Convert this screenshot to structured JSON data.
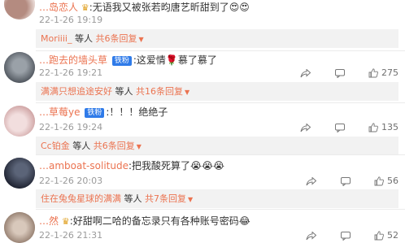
{
  "comments": [
    {
      "user": "…岛恋人",
      "crown": "♛",
      "text": ":无语我又被张若昀唐艺昕甜到了",
      "emoji": "😍😍",
      "date": "22-1-26 19:19",
      "reply": {
        "users": "Moriiii_",
        "and_others": "等人",
        "count_label": "共6条回复",
        "arrow": "▼"
      }
    },
    {
      "user": "…跑去的墙头草",
      "badge": "铁粉",
      "text": ":这爱情",
      "text2": "慕了慕了",
      "emoji": "🌹",
      "date": "22-1-26 19:21",
      "share": "",
      "comment": "",
      "like": "275",
      "reply": {
        "users": "满满只想追途安好",
        "and_others": "等人",
        "count_label": "共16条回复",
        "arrow": "▼"
      }
    },
    {
      "user": "…草莓ye",
      "badge": "铁粉",
      "text": ":！！！绝绝子",
      "date": "22-1-26 19:24",
      "share": "",
      "comment": "",
      "like": "135",
      "reply": {
        "users": "Cc铂金",
        "and_others": "等人",
        "count_label": "共6条回复",
        "arrow": "▼"
      }
    },
    {
      "user": "…amboat-solitude",
      "text": ":把我酸死算了",
      "emoji": "😭😭😭",
      "date": "22-1-26 20:03",
      "share": "",
      "comment": "",
      "like": "56",
      "reply": {
        "users": "住在兔兔星球的满满",
        "and_others": "等人",
        "count_label": "共7条回复",
        "arrow": "▼"
      }
    },
    {
      "user": "…然",
      "crown": "♛",
      "text": ":好甜啊二哈的备忘录只有各种账号密码",
      "emoji": "😂",
      "date": "22-1-26 21:31",
      "share": "",
      "comment": "",
      "like": "52"
    }
  ],
  "colors": {
    "username": "#eb7350",
    "badge": "#2f7be9",
    "reply_bg": "#f2f2f2",
    "date": "#9a9a9a"
  },
  "icons": {
    "share": "share-icon",
    "comment": "comment-icon",
    "like": "like-icon"
  }
}
